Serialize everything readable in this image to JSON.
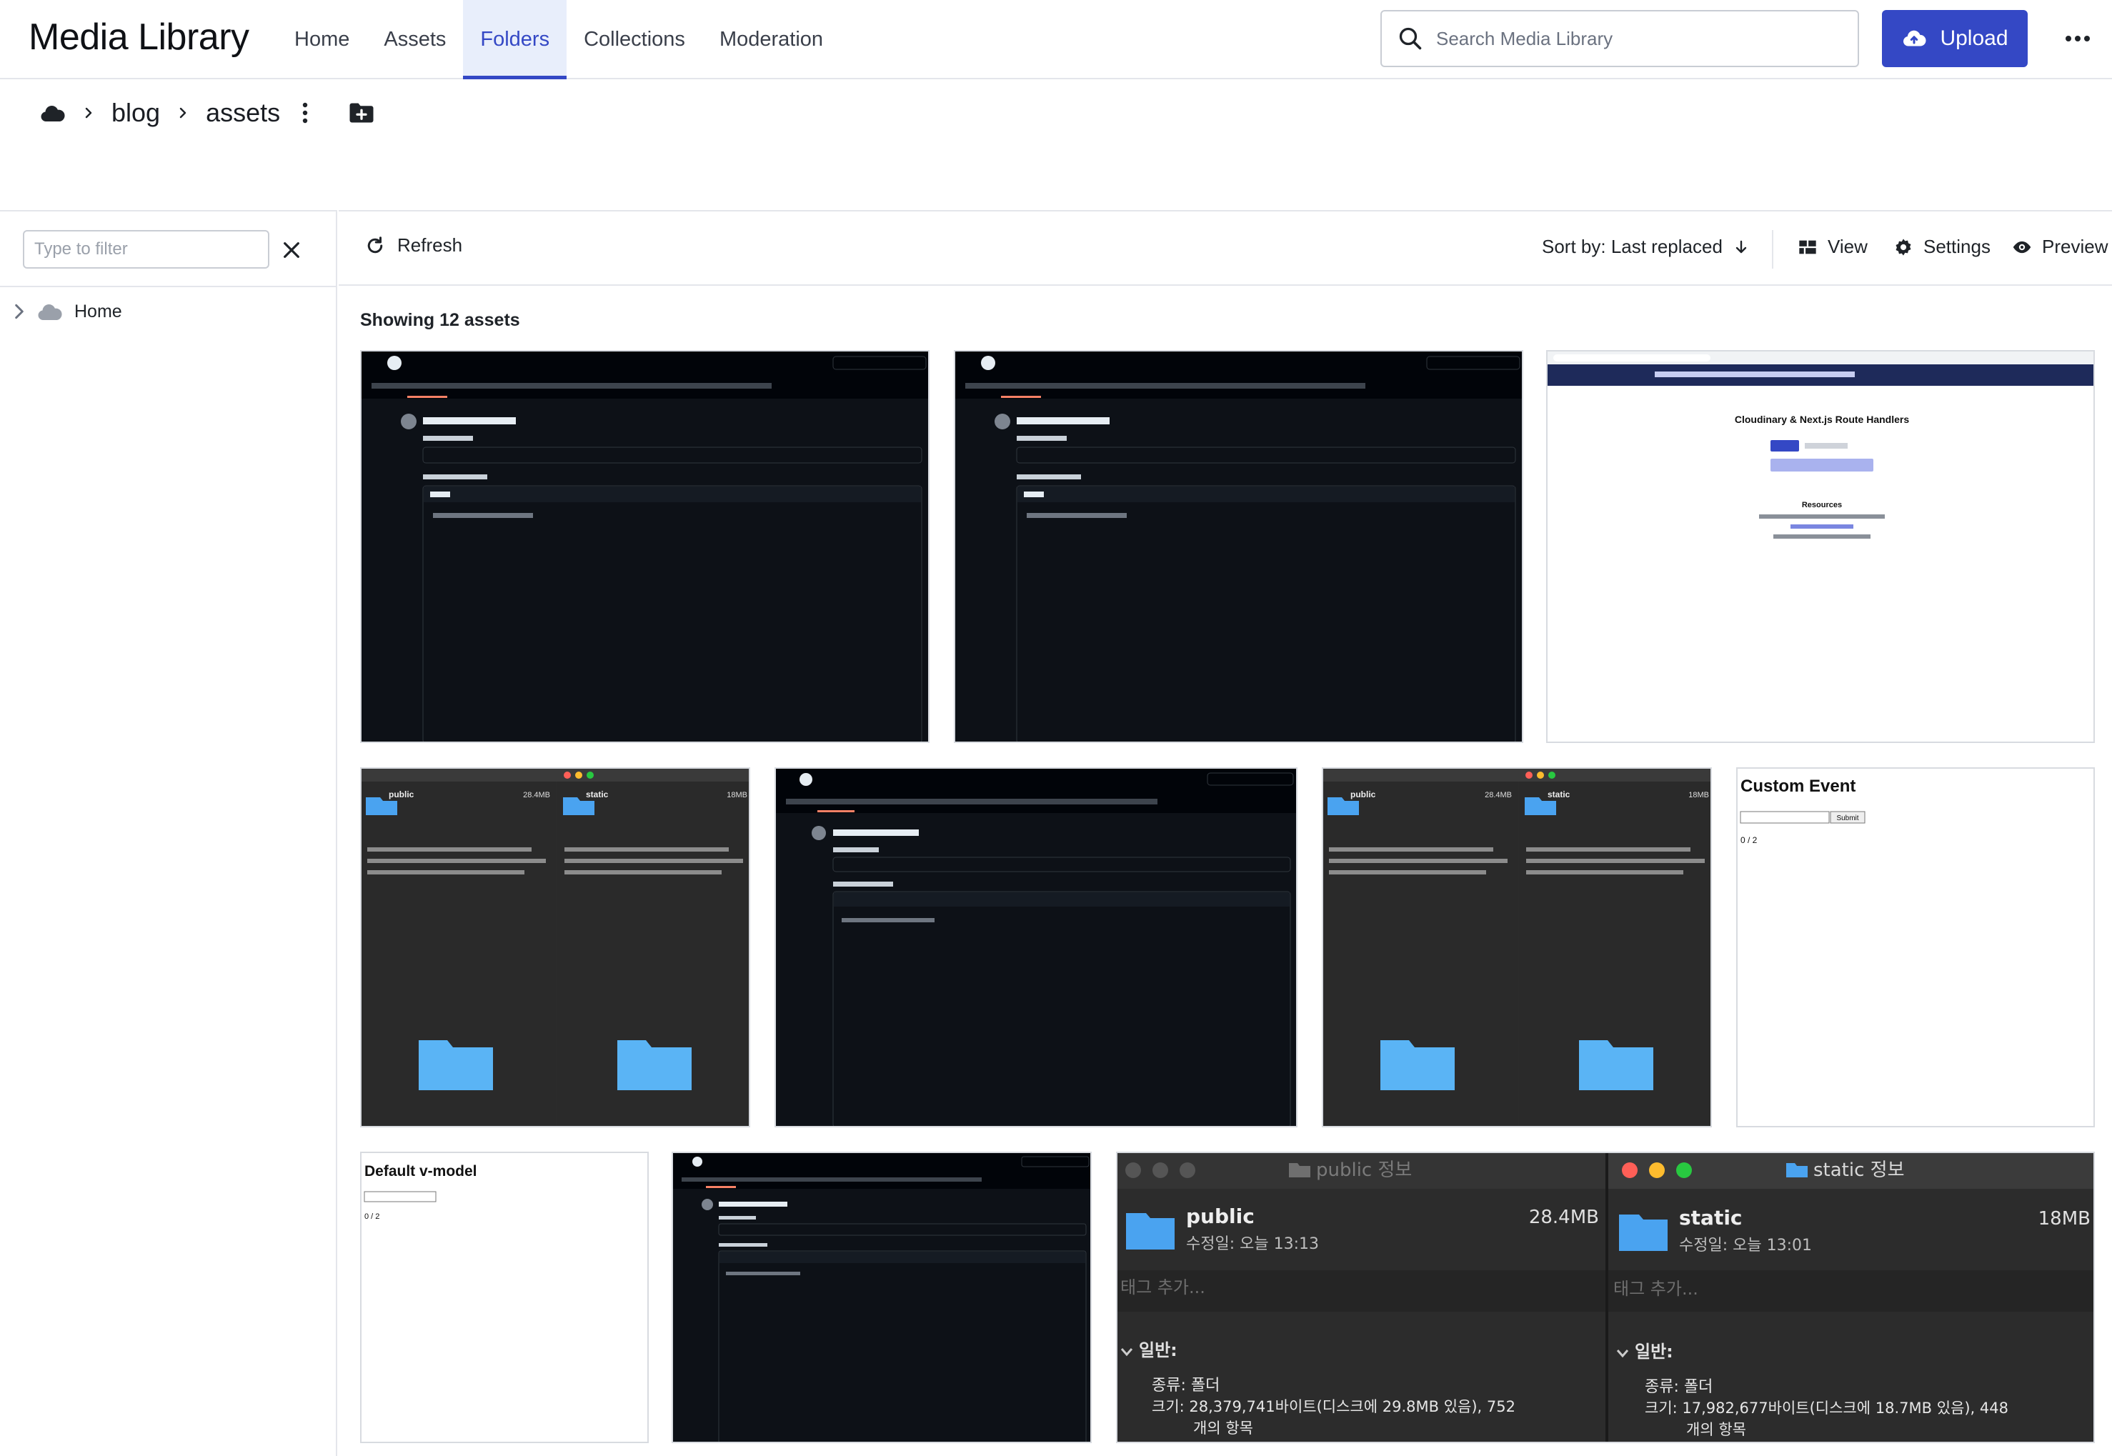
{
  "header": {
    "app_title": "Media Library",
    "tabs": [
      {
        "label": "Home",
        "active": false
      },
      {
        "label": "Assets",
        "active": false
      },
      {
        "label": "Folders",
        "active": true
      },
      {
        "label": "Collections",
        "active": false
      },
      {
        "label": "Moderation",
        "active": false
      }
    ],
    "search_placeholder": "Search Media Library",
    "upload_label": "Upload",
    "accent_color": "#3448c5"
  },
  "breadcrumb": {
    "segments": [
      "blog",
      "assets"
    ]
  },
  "sidebar": {
    "filter_placeholder": "Type to filter",
    "tree": [
      {
        "label": "Home",
        "expanded": false
      }
    ]
  },
  "toolbar": {
    "refresh_label": "Refresh",
    "sort_label": "Sort by: Last replaced",
    "view_label": "View",
    "settings_label": "Settings",
    "preview_label": "Preview"
  },
  "content": {
    "count_label": "Showing 12 assets",
    "assets": [
      {
        "kind": "github-issue"
      },
      {
        "kind": "github-issue"
      },
      {
        "kind": "cloudinary-page",
        "page_title": "Cloudinary & Next.js Route Handlers",
        "section": "Resources"
      },
      {
        "kind": "mac-info",
        "left": {
          "name": "public",
          "size": "28.4MB"
        },
        "right": {
          "name": "static",
          "size": "18MB"
        }
      },
      {
        "kind": "github-issue"
      },
      {
        "kind": "mac-info",
        "left": {
          "name": "public",
          "size": "28.4MB"
        },
        "right": {
          "name": "static",
          "size": "18MB"
        }
      },
      {
        "kind": "demo-form",
        "heading": "Custom Event",
        "button": "Submit",
        "counter": "0 / 2"
      },
      {
        "kind": "demo-form",
        "heading": "Default v-model",
        "counter": "0 / 2"
      },
      {
        "kind": "github-issue"
      },
      {
        "kind": "mac-info-zoom",
        "left": {
          "title": "public 정보",
          "name": "public",
          "size": "28.4MB",
          "modified": "수정일: 오늘 13:13",
          "size_line": "크기: 28,379,741바이트(디스크에 29.8MB 있음), 752",
          "items_line": "개의 항목"
        },
        "right": {
          "title": "static 정보",
          "name": "static",
          "size": "18MB",
          "modified": "수정일: 오늘 13:01",
          "size_line": "크기: 17,982,677바이트(디스크에 18.7MB 있음), 448",
          "items_line": "개의 항목"
        },
        "tag_placeholder": "태그 추가...",
        "general": "일반:",
        "kind_line": "종류: 폴더"
      }
    ]
  }
}
